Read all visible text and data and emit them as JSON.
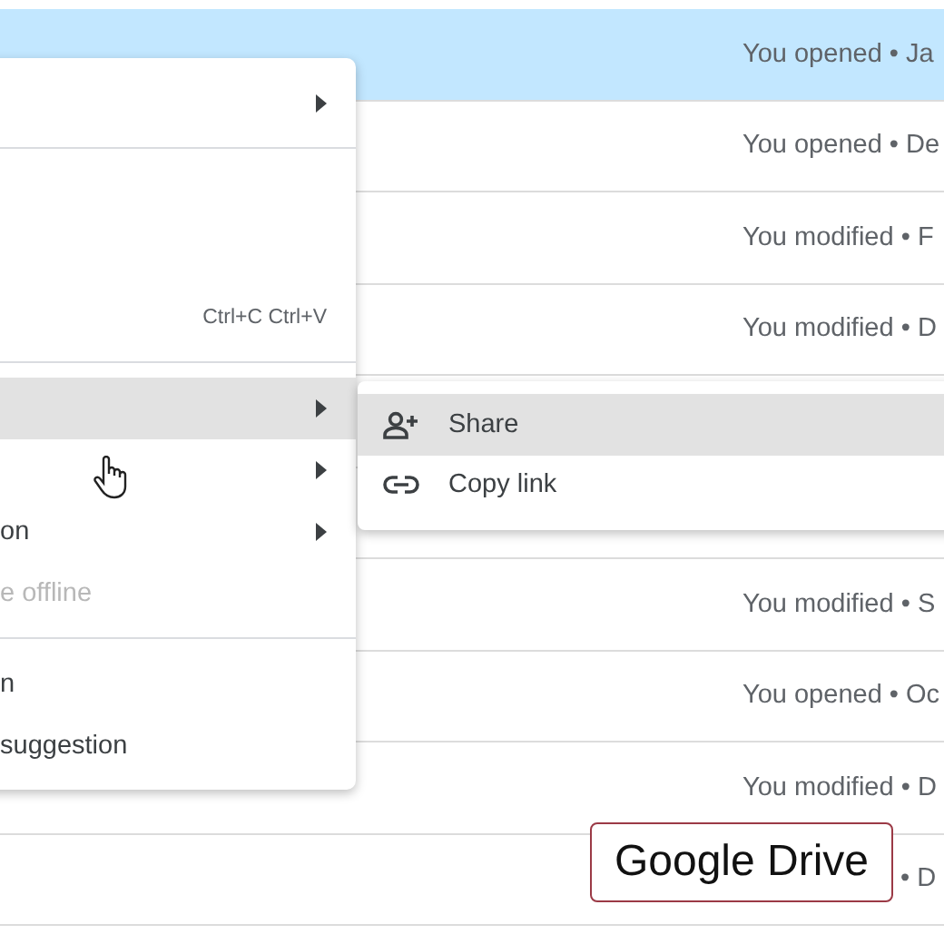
{
  "file_rows": [
    {
      "activity": "You opened • Ja",
      "selected": true
    },
    {
      "activity": "You opened • De",
      "selected": false
    },
    {
      "activity": "You modified • F",
      "selected": false
    },
    {
      "activity": "You modified • D",
      "selected": false
    },
    {
      "selected": false
    },
    {
      "selected": false
    },
    {
      "activity": "You modified • S",
      "selected": false
    },
    {
      "activity": "You opened • Oc",
      "selected": false
    },
    {
      "activity": "You modified • D",
      "selected": false
    },
    {
      "activity": "• D",
      "selected": false
    }
  ],
  "context_menu": {
    "sections": [
      {
        "items": [
          {
            "submenu": true,
            "hovered": false,
            "disabled": false
          }
        ]
      },
      {
        "items": [
          {
            "shortcut": "Ctrl+C Ctrl+V",
            "submenu": false,
            "hovered": false,
            "disabled": false
          }
        ]
      },
      {
        "items": [
          {
            "submenu": true,
            "hovered": true,
            "disabled": false
          },
          {
            "submenu": true,
            "hovered": false,
            "disabled": false
          },
          {
            "label": "on",
            "submenu": true,
            "hovered": false,
            "disabled": false
          },
          {
            "label": "e offline",
            "submenu": false,
            "hovered": false,
            "disabled": true
          }
        ]
      },
      {
        "items": [
          {
            "label": "n",
            "submenu": false,
            "hovered": false,
            "disabled": false
          },
          {
            "label": "suggestion",
            "submenu": false,
            "hovered": false,
            "disabled": false
          }
        ]
      }
    ]
  },
  "share_submenu": {
    "items": [
      {
        "kind": "share",
        "label": "Share",
        "hovered": true
      },
      {
        "kind": "link",
        "label": "Copy link",
        "hovered": false
      }
    ]
  },
  "caption": "Google Drive"
}
